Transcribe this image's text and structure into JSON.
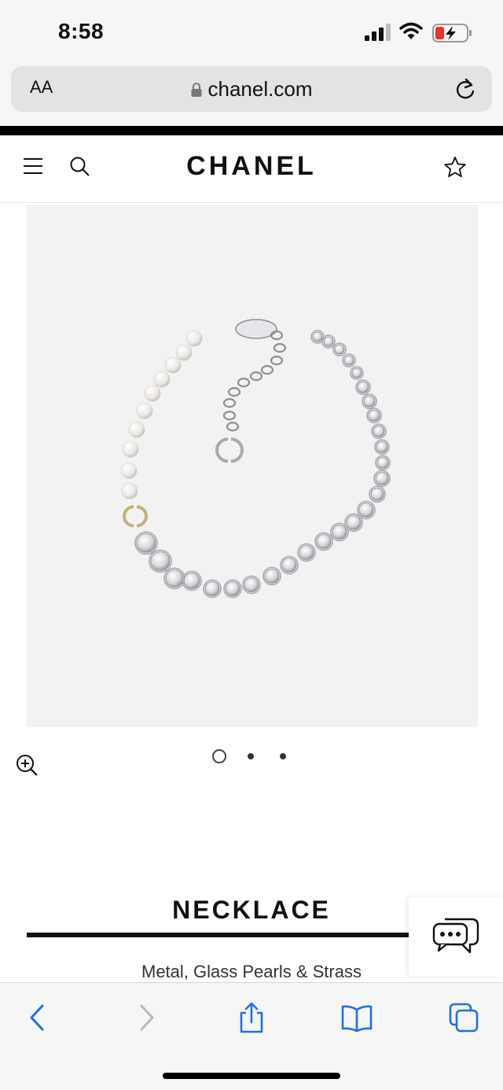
{
  "status_bar": {
    "time": "8:58",
    "icons": [
      "signal-icon",
      "wifi-icon",
      "battery-charging-icon"
    ],
    "battery_color": "#e8352b"
  },
  "browser": {
    "text_size_button": "AA",
    "url": "chanel.com",
    "icons": [
      "lock-icon",
      "reload-icon"
    ]
  },
  "site_header": {
    "logo": "CHANEL",
    "icons": [
      "menu-icon",
      "search-icon",
      "wishlist-star-icon"
    ]
  },
  "product": {
    "image": "necklace-photo",
    "carousel": {
      "count": 3,
      "active_index": 0
    },
    "title": "NECKLACE",
    "material": "Metal, Glass Pearls & Strass"
  },
  "chat": {
    "icon": "chat-bubble-icon"
  },
  "toolbar": {
    "accent": "#1f6fe5",
    "buttons": [
      "back-icon",
      "forward-icon",
      "share-icon",
      "bookmarks-icon",
      "tabs-icon"
    ]
  }
}
